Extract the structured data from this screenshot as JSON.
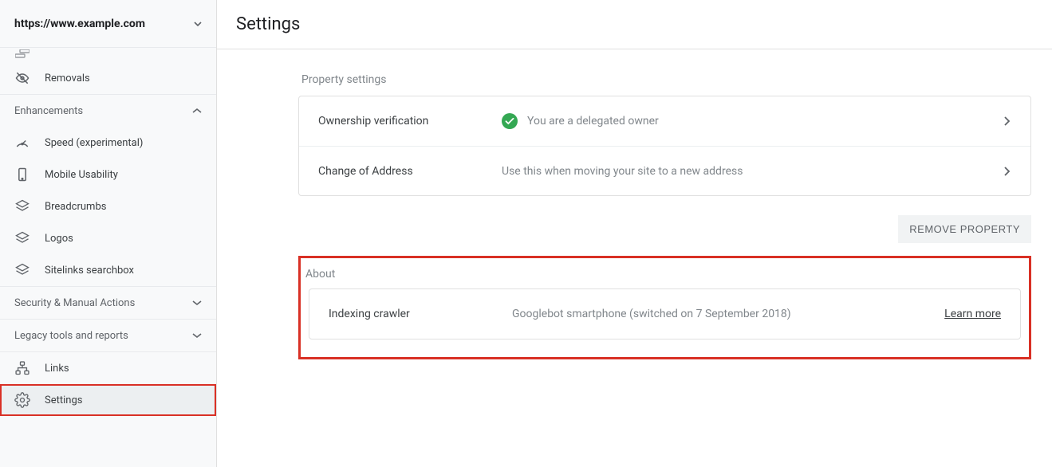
{
  "property_url": "https://www.example.com",
  "page_title": "Settings",
  "sidebar": {
    "removals": "Removals",
    "enhancements_header": "Enhancements",
    "speed": "Speed (experimental)",
    "mobile_usability": "Mobile Usability",
    "breadcrumbs": "Breadcrumbs",
    "logos": "Logos",
    "sitelinks": "Sitelinks searchbox",
    "security_header": "Security & Manual Actions",
    "legacy_header": "Legacy tools and reports",
    "links": "Links",
    "settings": "Settings"
  },
  "property_settings": {
    "label": "Property settings",
    "ownership": {
      "title": "Ownership verification",
      "status": "You are a delegated owner"
    },
    "change_address": {
      "title": "Change of Address",
      "status": "Use this when moving your site to a new address"
    },
    "remove_btn": "REMOVE PROPERTY"
  },
  "about": {
    "label": "About",
    "crawler": {
      "title": "Indexing crawler",
      "status": "Googlebot smartphone (switched on 7 September 2018)",
      "link": "Learn more"
    }
  }
}
